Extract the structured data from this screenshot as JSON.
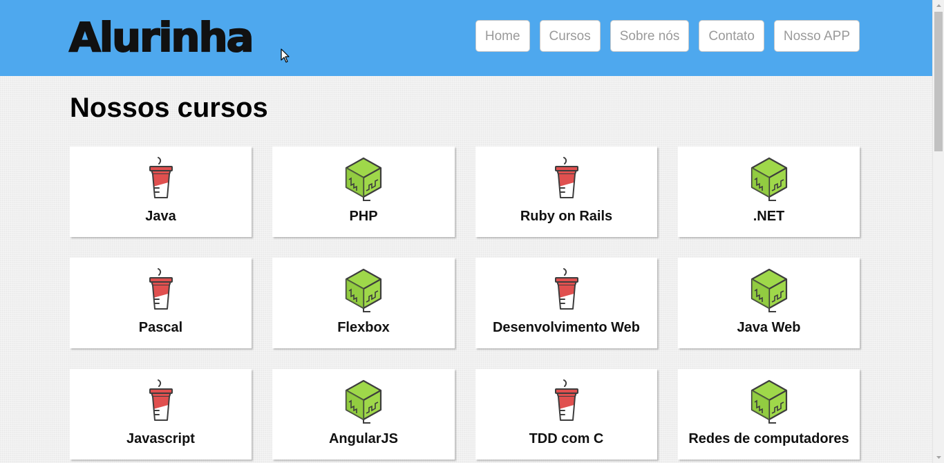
{
  "header": {
    "logo": "Alurinha",
    "nav": [
      {
        "label": "Home"
      },
      {
        "label": "Cursos"
      },
      {
        "label": "Sobre nós"
      },
      {
        "label": "Contato"
      },
      {
        "label": "Nosso APP"
      }
    ]
  },
  "main": {
    "title": "Nossos cursos",
    "courses": [
      {
        "name": "Java",
        "icon": "coffee-cup-icon"
      },
      {
        "name": "PHP",
        "icon": "cube-icon"
      },
      {
        "name": "Ruby on Rails",
        "icon": "coffee-cup-icon"
      },
      {
        "name": ".NET",
        "icon": "cube-icon"
      },
      {
        "name": "Pascal",
        "icon": "coffee-cup-icon"
      },
      {
        "name": "Flexbox",
        "icon": "cube-icon"
      },
      {
        "name": "Desenvolvimento Web",
        "icon": "coffee-cup-icon"
      },
      {
        "name": "Java Web",
        "icon": "cube-icon"
      },
      {
        "name": "Javascript",
        "icon": "coffee-cup-icon"
      },
      {
        "name": "AngularJS",
        "icon": "cube-icon"
      },
      {
        "name": "TDD com C",
        "icon": "coffee-cup-icon"
      },
      {
        "name": "Redes de computadores",
        "icon": "cube-icon"
      }
    ]
  },
  "colors": {
    "header_bg": "#4ea8ee",
    "cup_red": "#e0504f",
    "cube_green": "#9fd84a",
    "icon_stroke": "#3d3d3d"
  }
}
